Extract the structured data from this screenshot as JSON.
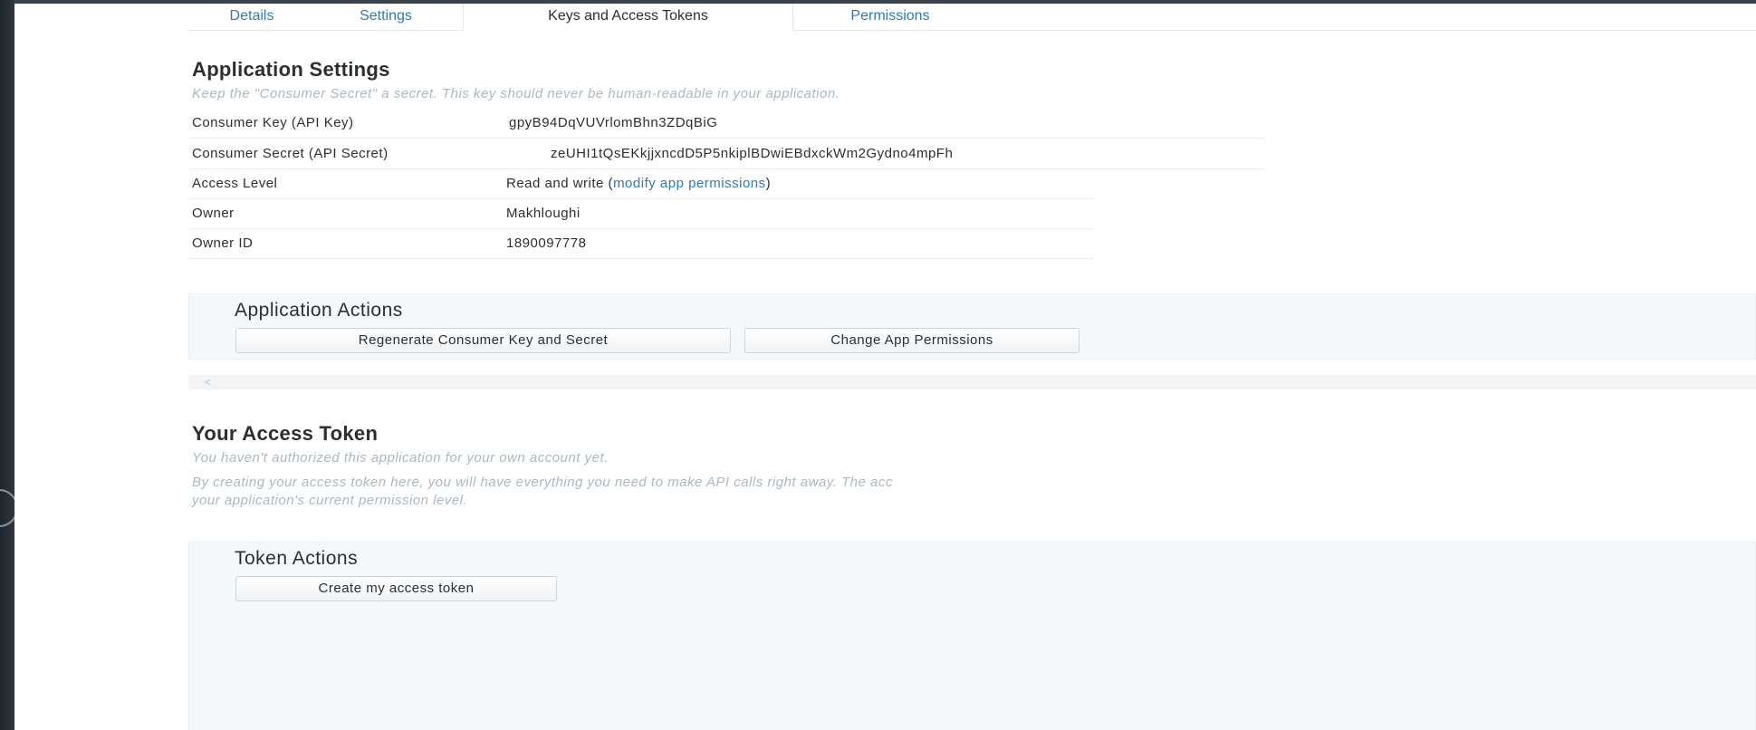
{
  "tabs": [
    {
      "label": "Details"
    },
    {
      "label": "Settings"
    },
    {
      "label": "Keys and Access Tokens"
    },
    {
      "label": "Permissions"
    }
  ],
  "application_settings": {
    "title": "Application Settings",
    "note": "Keep the \"Consumer Secret\" a secret. This key should never be human-readable in your application.",
    "rows": [
      {
        "key": "Consumer Key (API Key)",
        "value": "gpyB94DqVUVrlomBhn3ZDqBiG"
      },
      {
        "key": "Consumer Secret (API Secret)",
        "value": "zeUHI1tQsEKkjjxncdD5P5nkiplBDwiEBdxckWm2Gydno4mpFh"
      },
      {
        "key": "Access Level",
        "value": "Read and write (",
        "link": "modify app permissions",
        "suffix": ")"
      },
      {
        "key": "Owner",
        "value": "Makhloughi"
      },
      {
        "key": "Owner ID",
        "value": "1890097778"
      }
    ]
  },
  "application_actions": {
    "title": "Application Actions",
    "regenerate_label": "Regenerate Consumer Key and Secret",
    "change_permissions_label": "Change App Permissions"
  },
  "scrollbar": {
    "left_arrow": "<"
  },
  "access_token": {
    "title": "Your Access Token",
    "note1": "You haven't authorized this application for your own account yet.",
    "note2_line1": "By creating your access token here, you will have everything you need to make API calls right away. The acc",
    "note2_line2": "your application's current permission level."
  },
  "token_actions": {
    "title": "Token Actions",
    "create_label": "Create my access token"
  },
  "colors": {
    "link": "#2b7bb9",
    "text": "#292f33",
    "muted": "#aab8c2",
    "panel": "#f5f8fa"
  }
}
